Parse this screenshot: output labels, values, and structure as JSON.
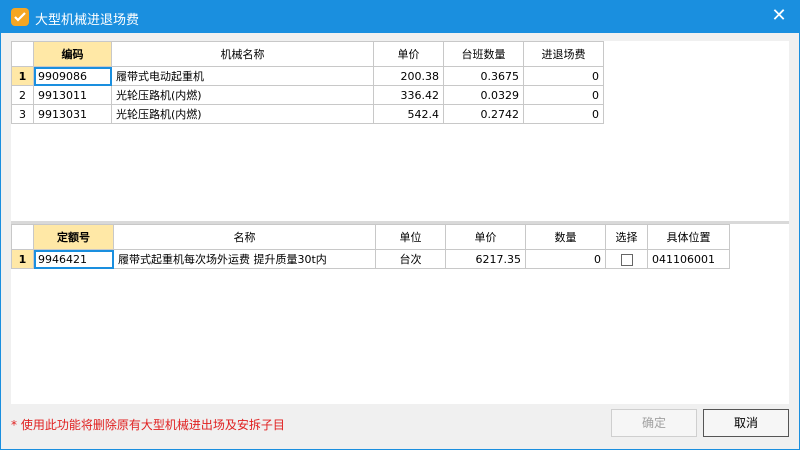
{
  "window": {
    "title": "大型机械进退场费"
  },
  "top_table": {
    "headers": [
      "编码",
      "机械名称",
      "单价",
      "台班数量",
      "进退场费"
    ],
    "rows": [
      {
        "num": "1",
        "code": "9909086",
        "name": "履带式电动起重机",
        "price": "200.38",
        "qty": "0.3675",
        "fee": "0"
      },
      {
        "num": "2",
        "code": "9913011",
        "name": "光轮压路机(内燃)",
        "price": "336.42",
        "qty": "0.0329",
        "fee": "0"
      },
      {
        "num": "3",
        "code": "9913031",
        "name": "光轮压路机(内燃)",
        "price": "542.4",
        "qty": "0.2742",
        "fee": "0"
      }
    ]
  },
  "bottom_table": {
    "headers": [
      "定额号",
      "名称",
      "单位",
      "单价",
      "数量",
      "选择",
      "具体位置"
    ],
    "rows": [
      {
        "num": "1",
        "code": "9946421",
        "name": "履带式起重机每次场外运费 提升质量30t内",
        "unit": "台次",
        "price": "6217.35",
        "qty": "0",
        "location": "041106001"
      }
    ]
  },
  "footer": {
    "note": "* 使用此功能将删除原有大型机械进出场及安拆子目",
    "ok_label": "确定",
    "cancel_label": "取消"
  }
}
